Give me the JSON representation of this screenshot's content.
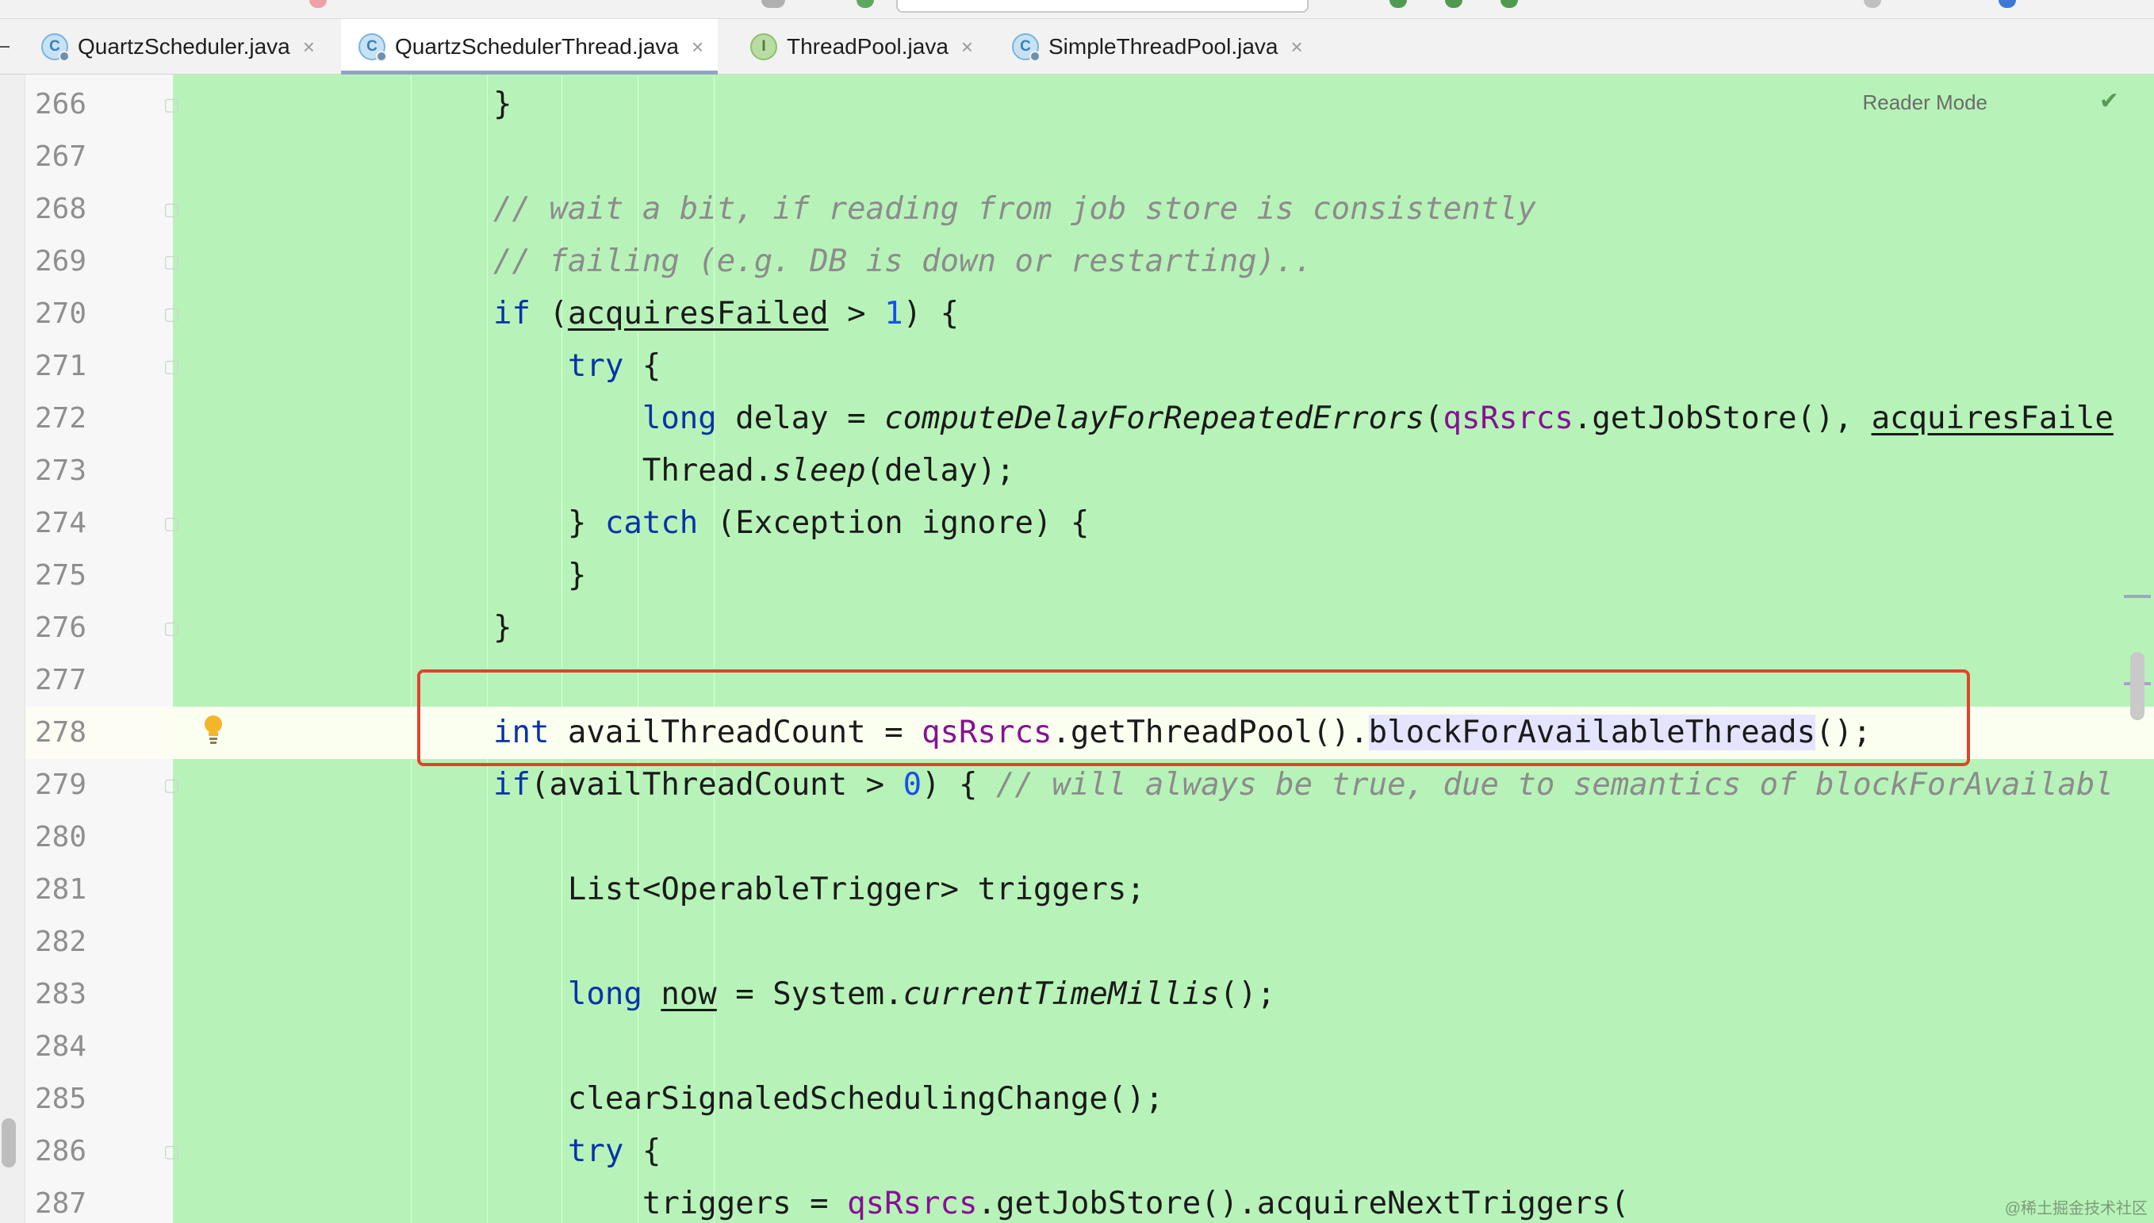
{
  "tabs": [
    {
      "label": "QuartzScheduler.java",
      "icon": "class-icon",
      "icon_letter": "C",
      "active": false
    },
    {
      "label": "QuartzSchedulerThread.java",
      "icon": "class-icon",
      "icon_letter": "C",
      "active": true
    },
    {
      "label": "ThreadPool.java",
      "icon": "interface-icon",
      "icon_letter": "I",
      "active": false
    },
    {
      "label": "SimpleThreadPool.java",
      "icon": "class-icon",
      "icon_letter": "C",
      "active": false
    }
  ],
  "tab_close_glyph": "×",
  "editor": {
    "reader_mode_label": "Reader Mode",
    "reader_mode_check": "✔",
    "current_line": "278",
    "inspection_icon": "bulb-icon",
    "colors": {
      "background": "#b7f3b8",
      "keyword": "#0b33a8",
      "number": "#1750eb",
      "comment": "#8c8c8c",
      "field": "#871094",
      "highlight_box": "#e2432d"
    }
  },
  "code_lines": [
    {
      "n": "266",
      "tokens": [
        {
          "t": "}"
        }
      ]
    },
    {
      "n": "267",
      "tokens": []
    },
    {
      "n": "268",
      "tokens": [
        {
          "t": "// wait a bit, if reading from job store is consistently",
          "c": "cmt"
        }
      ]
    },
    {
      "n": "269",
      "tokens": [
        {
          "t": "// failing (e.g. DB is down or restarting)..",
          "c": "cmt"
        }
      ]
    },
    {
      "n": "270",
      "tokens": [
        {
          "t": "if",
          "c": "kw"
        },
        {
          "t": " ("
        },
        {
          "t": "acquiresFailed",
          "c": "ul"
        },
        {
          "t": " > "
        },
        {
          "t": "1",
          "c": "num"
        },
        {
          "t": ") {"
        }
      ]
    },
    {
      "n": "271",
      "tokens": [
        {
          "t": "    "
        },
        {
          "t": "try",
          "c": "kw"
        },
        {
          "t": " {"
        }
      ]
    },
    {
      "n": "272",
      "tokens": [
        {
          "t": "        "
        },
        {
          "t": "long",
          "c": "kw"
        },
        {
          "t": " delay = "
        },
        {
          "t": "computeDelayForRepeatedErrors",
          "c": "it"
        },
        {
          "t": "("
        },
        {
          "t": "qsRsrcs",
          "c": "fld"
        },
        {
          "t": ".getJobStore(), "
        },
        {
          "t": "acquiresFaile",
          "c": "ul"
        }
      ]
    },
    {
      "n": "273",
      "tokens": [
        {
          "t": "        Thread."
        },
        {
          "t": "sleep",
          "c": "it"
        },
        {
          "t": "(delay);"
        }
      ]
    },
    {
      "n": "274",
      "tokens": [
        {
          "t": "    } "
        },
        {
          "t": "catch",
          "c": "kw"
        },
        {
          "t": " (Exception ignore) {"
        }
      ]
    },
    {
      "n": "275",
      "tokens": [
        {
          "t": "    }"
        }
      ]
    },
    {
      "n": "276",
      "tokens": [
        {
          "t": "}"
        }
      ]
    },
    {
      "n": "277",
      "tokens": []
    },
    {
      "n": "278",
      "tokens": [
        {
          "t": "int",
          "c": "kw"
        },
        {
          "t": " availThreadCount = "
        },
        {
          "t": "qsRsrcs",
          "c": "fld"
        },
        {
          "t": ".getThreadPool()."
        },
        {
          "t": "blockForAvailableThreads",
          "c": "hl"
        },
        {
          "t": "();"
        }
      ]
    },
    {
      "n": "279",
      "tokens": [
        {
          "t": "if",
          "c": "kw"
        },
        {
          "t": "(availThreadCount > "
        },
        {
          "t": "0",
          "c": "num"
        },
        {
          "t": ") { "
        },
        {
          "t": "// will always be true, due to semantics of blockForAvailabl",
          "c": "cmt"
        }
      ]
    },
    {
      "n": "280",
      "tokens": []
    },
    {
      "n": "281",
      "tokens": [
        {
          "t": "    List<OperableTrigger> triggers;"
        }
      ]
    },
    {
      "n": "282",
      "tokens": []
    },
    {
      "n": "283",
      "tokens": [
        {
          "t": "    "
        },
        {
          "t": "long",
          "c": "kw"
        },
        {
          "t": " "
        },
        {
          "t": "now",
          "c": "ul"
        },
        {
          "t": " = System."
        },
        {
          "t": "currentTimeMillis",
          "c": "it"
        },
        {
          "t": "();"
        }
      ]
    },
    {
      "n": "284",
      "tokens": []
    },
    {
      "n": "285",
      "tokens": [
        {
          "t": "    clearSignaledSchedulingChange();"
        }
      ]
    },
    {
      "n": "286",
      "tokens": [
        {
          "t": "    "
        },
        {
          "t": "try",
          "c": "kw"
        },
        {
          "t": " {"
        }
      ]
    },
    {
      "n": "287",
      "tokens": [
        {
          "t": "        triggers = "
        },
        {
          "t": "qsRsrcs",
          "c": "fld"
        },
        {
          "t": ".getJobStore().acquireNextTriggers("
        }
      ]
    }
  ],
  "watermark": "@稀土掘金技术社区"
}
